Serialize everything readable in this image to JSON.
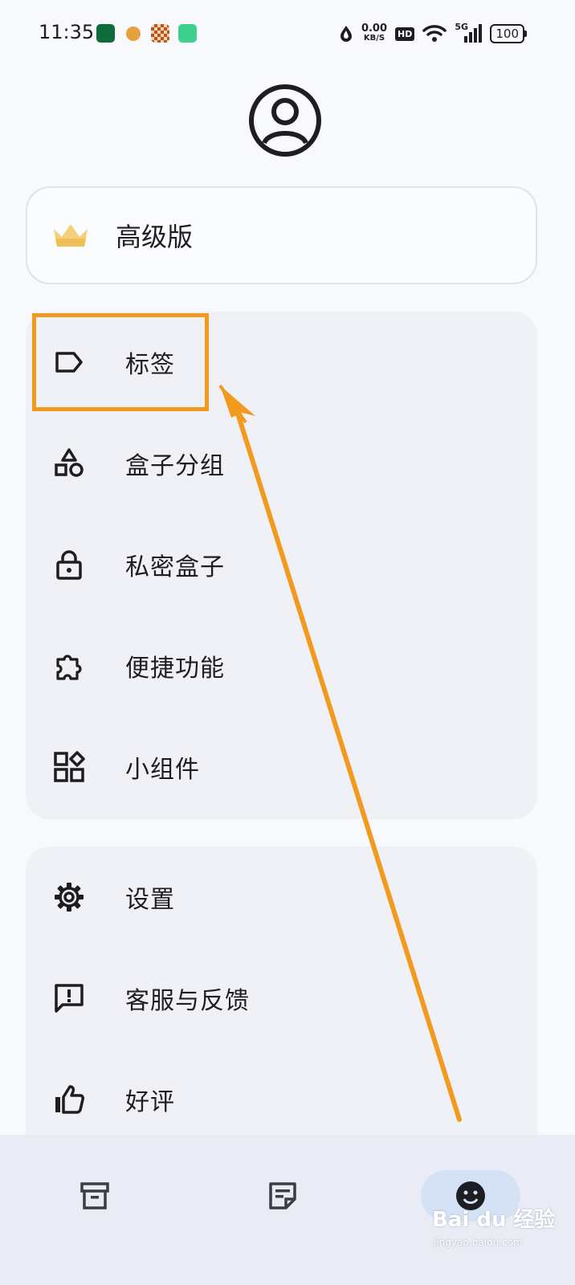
{
  "status_bar": {
    "time": "11:35",
    "net_speed_value": "0.00",
    "net_speed_unit": "KB/S",
    "hd": "HD",
    "signal": "5G",
    "battery": "100"
  },
  "premium": {
    "label": "高级版"
  },
  "menu": {
    "group1": [
      {
        "label": "标签",
        "icon": "tag-icon"
      },
      {
        "label": "盒子分组",
        "icon": "shapes-icon"
      },
      {
        "label": "私密盒子",
        "icon": "lock-icon"
      },
      {
        "label": "便捷功能",
        "icon": "puzzle-icon"
      },
      {
        "label": "小组件",
        "icon": "widgets-icon"
      }
    ],
    "group2": [
      {
        "label": "设置",
        "icon": "gear-icon"
      },
      {
        "label": "客服与反馈",
        "icon": "feedback-icon"
      },
      {
        "label": "好评",
        "icon": "thumbs-up-icon"
      }
    ]
  },
  "bottom_nav": [
    "archive-icon",
    "note-icon",
    "face-icon"
  ],
  "colors": {
    "annotation": "#f39a1e",
    "active_nav": "#d5e2f6",
    "card_bg": "#eff1f7"
  },
  "watermark": {
    "brand": "Bai du 经验",
    "url": "jingyan.baidu.com"
  }
}
